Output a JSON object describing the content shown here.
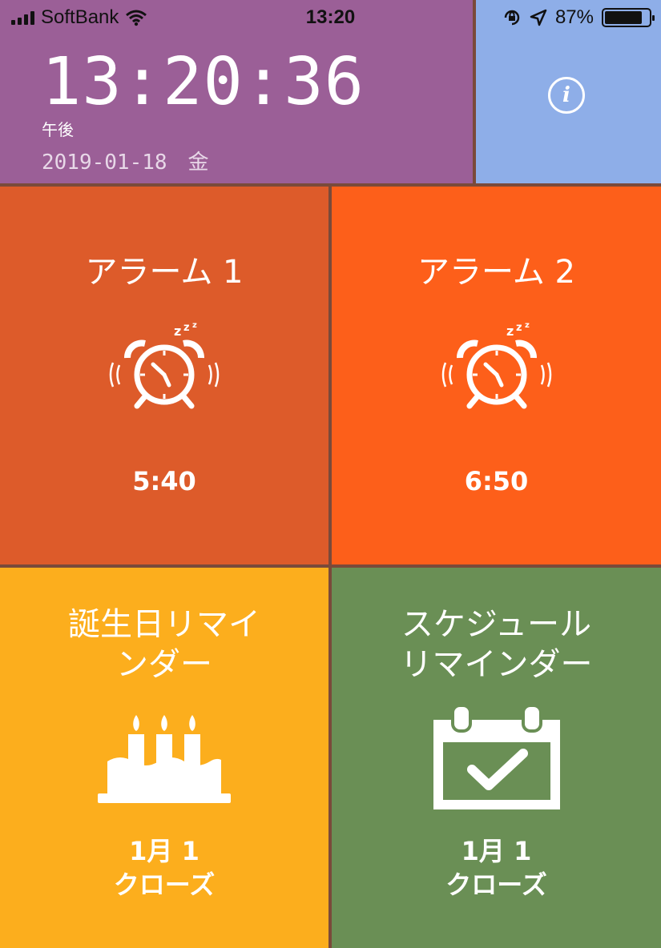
{
  "status_bar": {
    "carrier": "SoftBank",
    "time": "13:20",
    "battery": "87%",
    "battery_level": 0.87
  },
  "clock": {
    "time": "13:20:36",
    "ampm": "午後",
    "date": "2019-01-18　金"
  },
  "info": {
    "icon": "info-icon",
    "glyph": "i"
  },
  "tiles": [
    {
      "title": "アラーム 1",
      "value": "5:40",
      "icon": "alarm-clock-icon",
      "color": "#dd5b2a"
    },
    {
      "title": "アラーム 2",
      "value": "6:50",
      "icon": "alarm-clock-icon",
      "color": "#fd5f1a"
    },
    {
      "title_lines": [
        "誕生日リマイ",
        "ンダー"
      ],
      "value_lines": [
        "1月 1",
        "クローズ"
      ],
      "icon": "birthday-cake-icon",
      "color": "#fcae1d"
    },
    {
      "title_lines": [
        "スケジュール",
        "リマインダー"
      ],
      "value_lines": [
        "1月 1",
        "クローズ"
      ],
      "icon": "calendar-check-icon",
      "color": "#6a8f55"
    }
  ],
  "colors": {
    "clock_tile": "#9b5f97",
    "info_tile": "#8eaee8"
  }
}
